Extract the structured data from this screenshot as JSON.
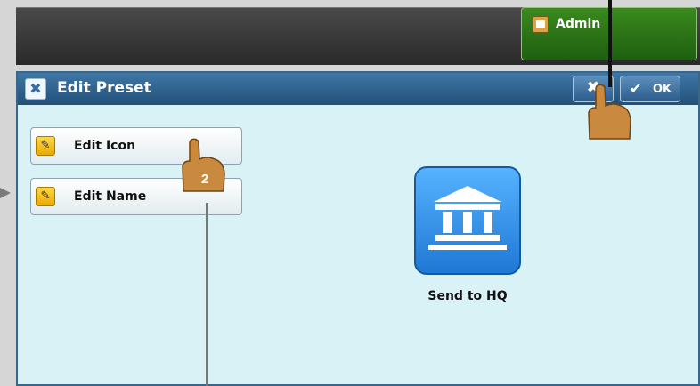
{
  "header": {
    "admin_label": "Admin"
  },
  "dialog": {
    "title": "Edit Preset",
    "ok_label": "OK",
    "close_symbol": "✖",
    "edit_icon_label": "Edit Icon",
    "edit_name_label": "Edit Name",
    "preset_name": "Send to HQ"
  },
  "callouts": {
    "step_number": "2"
  },
  "icons": {
    "admin": "clipboard-check-icon",
    "title": "tools-icon",
    "pencil": "pencil-icon",
    "preset": "bank-building-icon",
    "hand": "pointing-hand-icon"
  },
  "colors": {
    "admin_green": "#2f7a18",
    "title_blue": "#2f6796",
    "dialog_bg": "#d9f2f6",
    "preset_blue": "#2a8be6"
  }
}
